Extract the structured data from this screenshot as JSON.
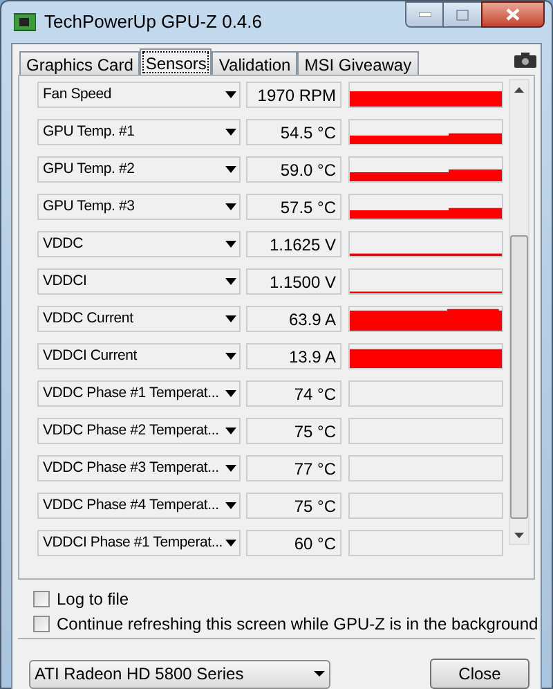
{
  "window": {
    "title": "TechPowerUp GPU-Z 0.4.6"
  },
  "tabs": [
    {
      "label": "Graphics Card",
      "selected": false
    },
    {
      "label": "Sensors",
      "selected": true
    },
    {
      "label": "Validation",
      "selected": false
    },
    {
      "label": "MSI Giveaway",
      "selected": false
    }
  ],
  "sensors": [
    {
      "name": "Fan Speed",
      "value": "1970 RPM"
    },
    {
      "name": "GPU Temp. #1",
      "value": "54.5 °C"
    },
    {
      "name": "GPU Temp. #2",
      "value": "59.0 °C"
    },
    {
      "name": "GPU Temp. #3",
      "value": "57.5 °C"
    },
    {
      "name": "VDDC",
      "value": "1.1625 V"
    },
    {
      "name": "VDDCI",
      "value": "1.1500 V"
    },
    {
      "name": "VDDC Current",
      "value": "63.9 A"
    },
    {
      "name": "VDDCI Current",
      "value": "13.9 A"
    },
    {
      "name": "VDDC Phase #1 Temperat...",
      "value": "74 °C"
    },
    {
      "name": "VDDC Phase #2 Temperat...",
      "value": "75 °C"
    },
    {
      "name": "VDDC Phase #3 Temperat...",
      "value": "77 °C"
    },
    {
      "name": "VDDC Phase #4 Temperat...",
      "value": "75 °C"
    },
    {
      "name": "VDDCI Phase #1 Temperat...",
      "value": "60 °C"
    }
  ],
  "options": [
    {
      "label": "Log to file",
      "checked": false
    },
    {
      "label": "Continue refreshing this screen while GPU-Z is in the background",
      "checked": false
    }
  ],
  "gpu_select": {
    "value": "ATI Radeon HD 5800 Series"
  },
  "close_button": {
    "label": "Close"
  }
}
